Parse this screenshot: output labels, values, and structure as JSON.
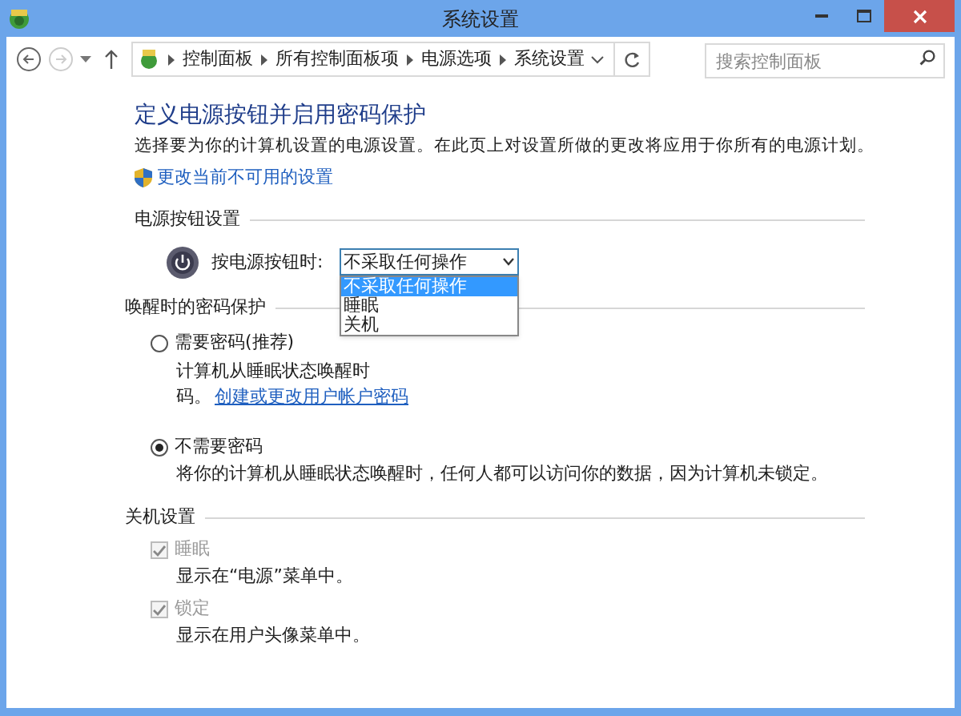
{
  "window": {
    "title": "系统设置"
  },
  "nav": {
    "breadcrumb": [
      "控制面板",
      "所有控制面板项",
      "电源选项",
      "系统设置"
    ],
    "search": {
      "placeholder": "搜索控制面板"
    }
  },
  "page": {
    "heading": "定义电源按钮并启用密码保护",
    "description": "选择要为你的计算机设置的电源设置。在此页上对设置所做的更改将应用于你所有的电源计划。",
    "change_link": "更改当前不可用的设置"
  },
  "power_button": {
    "title": "电源按钮设置",
    "label": "按电源按钮时:",
    "value": "不采取任何操作",
    "options": [
      {
        "label": "不采取任何操作",
        "selected": true
      },
      {
        "label": "睡眠",
        "selected": false
      },
      {
        "label": "关机",
        "selected": false
      }
    ]
  },
  "wake_password": {
    "title": "唤醒时的密码保护",
    "options": [
      {
        "label": "需要密码(推荐)",
        "selected": false,
        "description": "计算机从睡眠状态唤醒时",
        "continuation": "码。",
        "link": "创建或更改用户帐户密码"
      },
      {
        "label": "不需要密码",
        "selected": true,
        "description": "将你的计算机从睡眠状态唤醒时，任何人都可以访问你的数据，因为计算机未锁定。"
      }
    ]
  },
  "shutdown": {
    "title": "关机设置",
    "items": [
      {
        "label": "睡眠",
        "checked": true,
        "disabled": true,
        "description": "显示在“电源”菜单中。"
      },
      {
        "label": "锁定",
        "checked": true,
        "disabled": true,
        "description": "显示在用户头像菜单中。"
      }
    ]
  }
}
